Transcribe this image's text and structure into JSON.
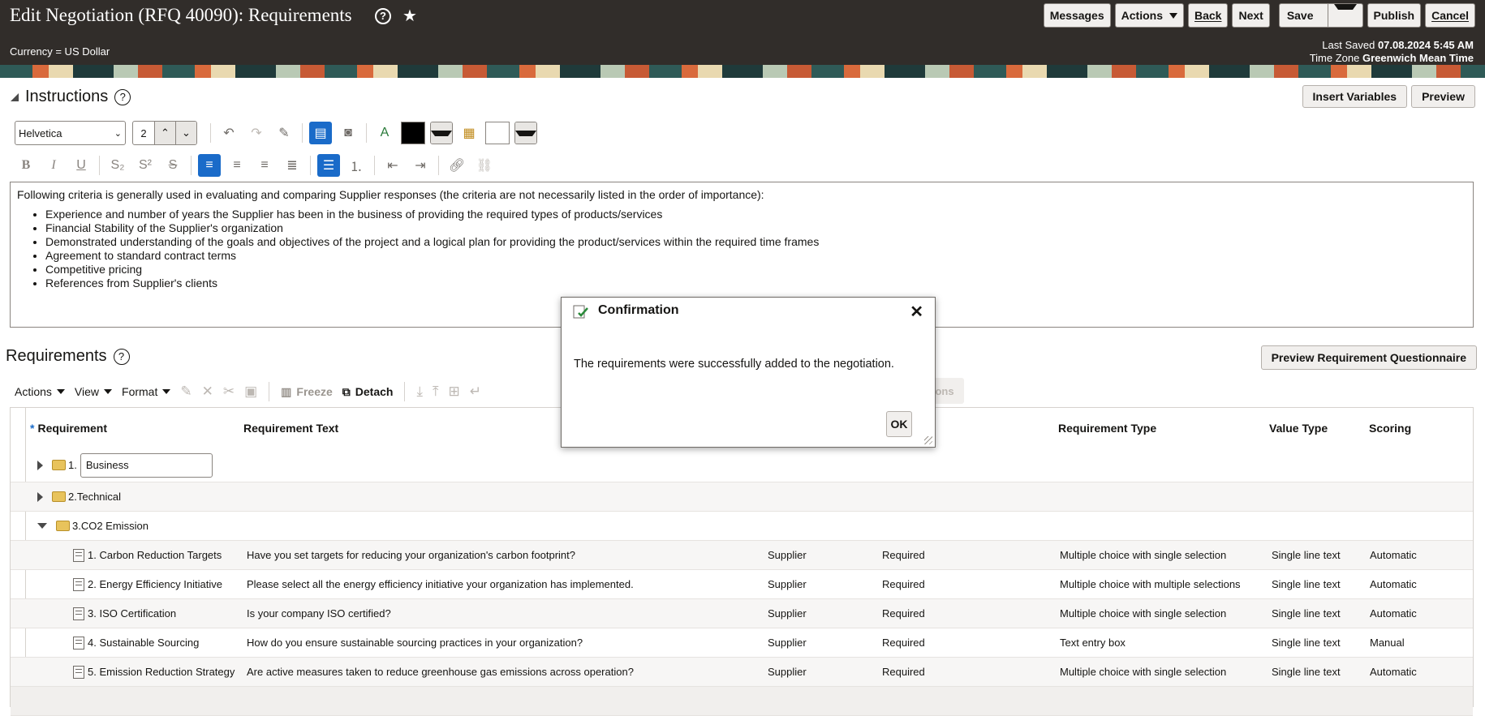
{
  "header": {
    "title": "Edit Negotiation (RFQ 40090): Requirements",
    "currency": "Currency = US Dollar",
    "last_saved_label": "Last Saved",
    "last_saved_value": "07.08.2024 5:45 AM",
    "timezone_label": "Time Zone",
    "timezone_value": "Greenwich Mean Time",
    "buttons": {
      "messages": "Messages",
      "actions": "Actions",
      "back": "Back",
      "next": "Next",
      "save": "Save",
      "publish": "Publish",
      "cancel": "Cancel"
    }
  },
  "instructions": {
    "title": "Instructions",
    "insert_variables": "Insert Variables",
    "preview": "Preview",
    "font_family": "Helvetica",
    "font_size": "2",
    "intro": "Following criteria is generally used in evaluating and comparing Supplier responses (the criteria are not necessarily listed in the order of importance):",
    "bullets": [
      "Experience and number of years the Supplier has been in the business of providing the required types of products/services",
      "Financial Stability of the Supplier's organization",
      "Demonstrated understanding of the goals and objectives of the project and a logical plan for providing the product/services within the required time frames",
      "Agreement to standard contract terms",
      "Competitive pricing",
      "References from Supplier's clients"
    ]
  },
  "requirements": {
    "title": "Requirements",
    "preview_questionnaire": "Preview Requirement Questionnaire",
    "toolbar": {
      "actions": "Actions",
      "view": "View",
      "format": "Format",
      "freeze": "Freeze",
      "detach": "Detach",
      "partial_label": "ons"
    },
    "columns": {
      "requirement": "Requirement",
      "requirement_text": "Requirement Text",
      "requirement_type": "Requirement Type",
      "value_type": "Value Type",
      "scoring": "Scoring"
    },
    "sections": [
      {
        "num": "1.",
        "name": "Business"
      },
      {
        "num": "2.",
        "name": "Technical"
      },
      {
        "num": "3.",
        "name": "CO2 Emission"
      }
    ],
    "rows": [
      {
        "num": "1.",
        "name": "Carbon Reduction Targets",
        "text": "Have you set targets for reducing your organization's carbon footprint?",
        "responder": "Supplier",
        "level": "Required",
        "type": "Multiple choice with single selection",
        "value_type": "Single line text",
        "scoring": "Automatic"
      },
      {
        "num": "2.",
        "name": "Energy Efficiency Initiative",
        "text": "Please select  all the energy efficiency initiative your organization has implemented.",
        "responder": "Supplier",
        "level": "Required",
        "type": "Multiple choice with multiple selections",
        "value_type": "Single line text",
        "scoring": "Automatic"
      },
      {
        "num": "3.",
        "name": "ISO Certification",
        "text": "Is your company ISO certified?",
        "responder": "Supplier",
        "level": "Required",
        "type": "Multiple choice with single selection",
        "value_type": "Single line text",
        "scoring": "Automatic"
      },
      {
        "num": "4.",
        "name": "Sustainable Sourcing",
        "text": "How do you ensure sustainable sourcing practices in your organization?",
        "responder": "Supplier",
        "level": "Required",
        "type": "Text entry box",
        "value_type": "Single line text",
        "scoring": "Manual"
      },
      {
        "num": "5.",
        "name": "Emission Reduction Strategy",
        "text": "Are active measures taken to reduce greenhouse gas emissions across operation?",
        "responder": "Supplier",
        "level": "Required",
        "type": "Multiple choice with single selection",
        "value_type": "Single line text",
        "scoring": "Automatic"
      }
    ]
  },
  "dialog": {
    "title": "Confirmation",
    "message": "The requirements were successfully added to the negotiation.",
    "ok": "OK"
  },
  "colors": {
    "header_bg": "#312d2a",
    "accent": "#1a6bc9"
  }
}
